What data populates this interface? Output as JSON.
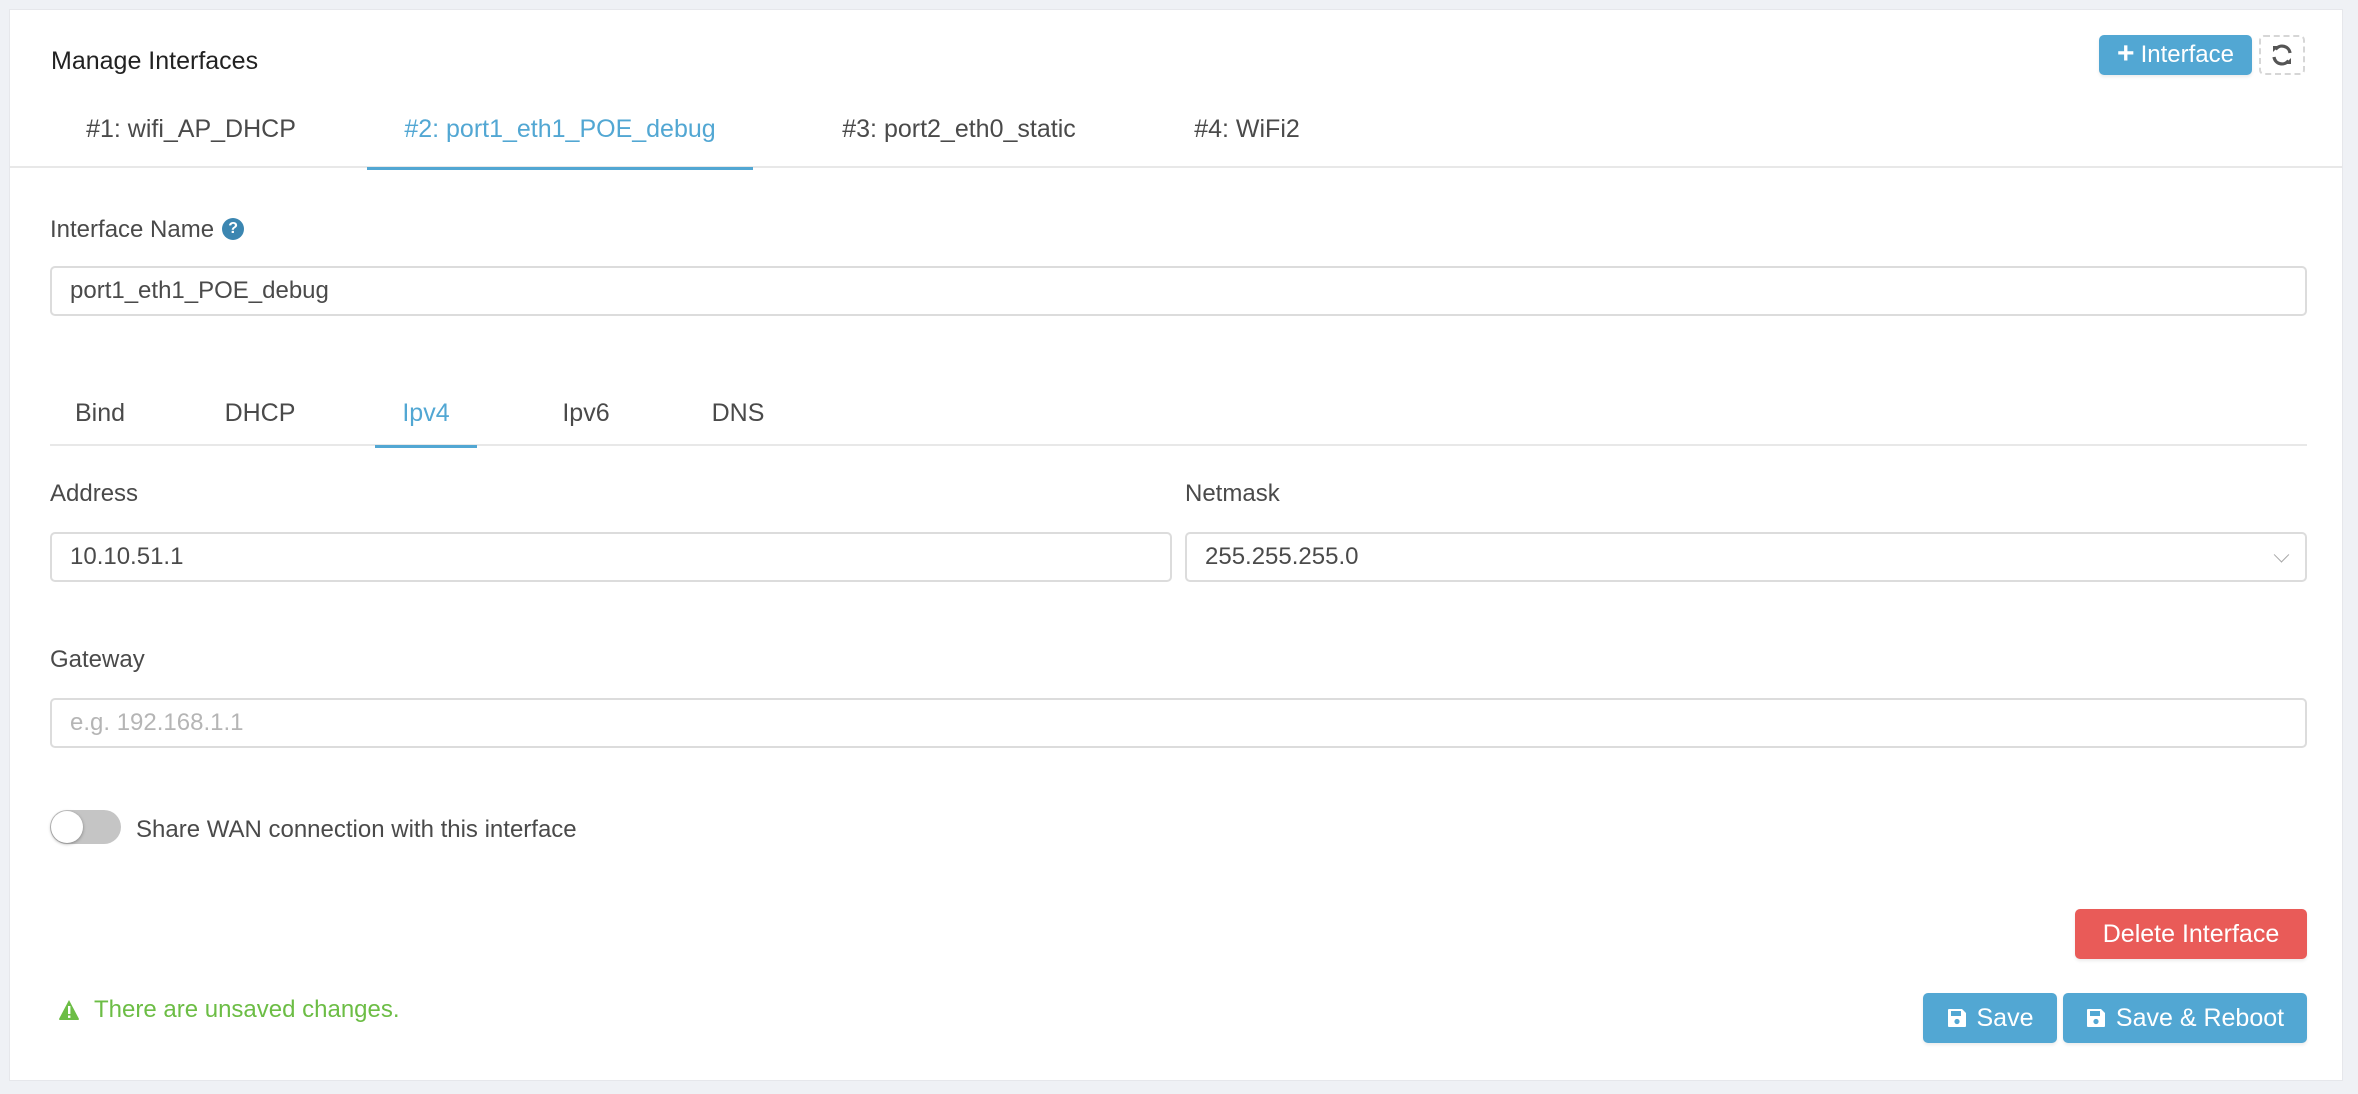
{
  "header": {
    "title": "Manage Interfaces",
    "add_button_label": "Interface",
    "add_icon": "plus-icon",
    "refresh_icon": "refresh-icon"
  },
  "interface_tabs": [
    {
      "label": "#1: wifi_AP_DHCP",
      "active": false
    },
    {
      "label": "#2: port1_eth1_POE_debug",
      "active": true
    },
    {
      "label": "#3: port2_eth0_static",
      "active": false
    },
    {
      "label": "#4: WiFi2",
      "active": false
    }
  ],
  "form": {
    "interface_name_label": "Interface Name",
    "interface_name_help_icon": "question-circle-icon",
    "interface_name_value": "port1_eth1_POE_debug",
    "section_tabs": [
      {
        "label": "Bind",
        "active": false
      },
      {
        "label": "DHCP",
        "active": false
      },
      {
        "label": "Ipv4",
        "active": true
      },
      {
        "label": "Ipv6",
        "active": false
      },
      {
        "label": "DNS",
        "active": false
      }
    ],
    "address_label": "Address",
    "address_value": "10.10.51.1",
    "netmask_label": "Netmask",
    "netmask_value": "255.255.255.0",
    "gateway_label": "Gateway",
    "gateway_value": "",
    "gateway_placeholder": "e.g. 192.168.1.1",
    "share_wan_label": "Share WAN connection with this interface",
    "share_wan_enabled": false
  },
  "actions": {
    "delete_label": "Delete Interface",
    "save_label": "Save",
    "save_reboot_label": "Save & Reboot",
    "save_icon": "floppy-disk-icon"
  },
  "status": {
    "unsaved_message": "There are unsaved changes.",
    "warning_icon": "warning-triangle-icon"
  },
  "colors": {
    "accent": "#52a7d3",
    "danger": "#e95b58",
    "success": "#6cbd45"
  }
}
